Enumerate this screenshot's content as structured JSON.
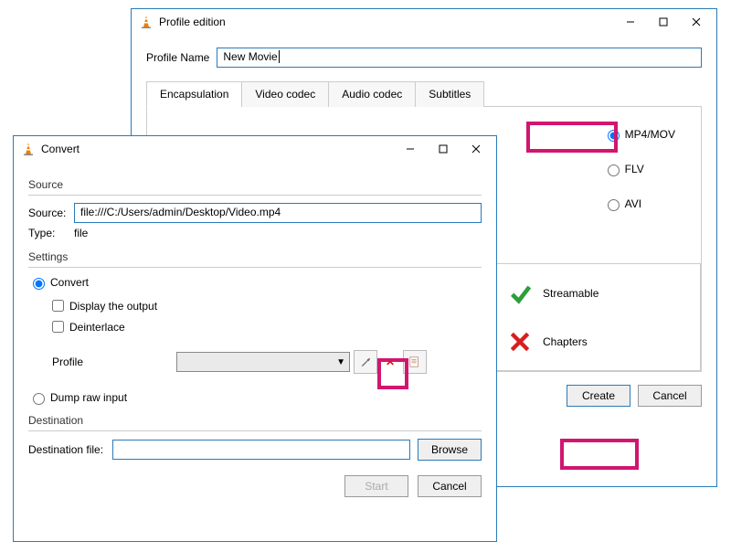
{
  "profile_window": {
    "title": "Profile edition",
    "profile_name_label": "Profile Name",
    "profile_name_value": "New Movie",
    "tabs": {
      "encapsulation": "Encapsulation",
      "video_codec": "Video codec",
      "audio_codec": "Audio codec",
      "subtitles": "Subtitles"
    },
    "options": {
      "mp4": "MP4/MOV",
      "flv": "FLV",
      "avi": "AVI"
    },
    "status": {
      "streamable": "Streamable",
      "chapters": "Chapters"
    },
    "create": "Create",
    "cancel": "Cancel"
  },
  "convert_window": {
    "title": "Convert",
    "source_group": "Source",
    "source_label": "Source:",
    "source_value": "file:///C:/Users/admin/Desktop/Video.mp4",
    "type_label": "Type:",
    "type_value": "file",
    "settings_group": "Settings",
    "convert_radio": "Convert",
    "display_output": "Display the output",
    "deinterlace": "Deinterlace",
    "profile_label": "Profile",
    "dump_raw": "Dump raw input",
    "destination_group": "Destination",
    "destination_file_label": "Destination file:",
    "browse": "Browse",
    "start": "Start",
    "cancel": "Cancel"
  }
}
